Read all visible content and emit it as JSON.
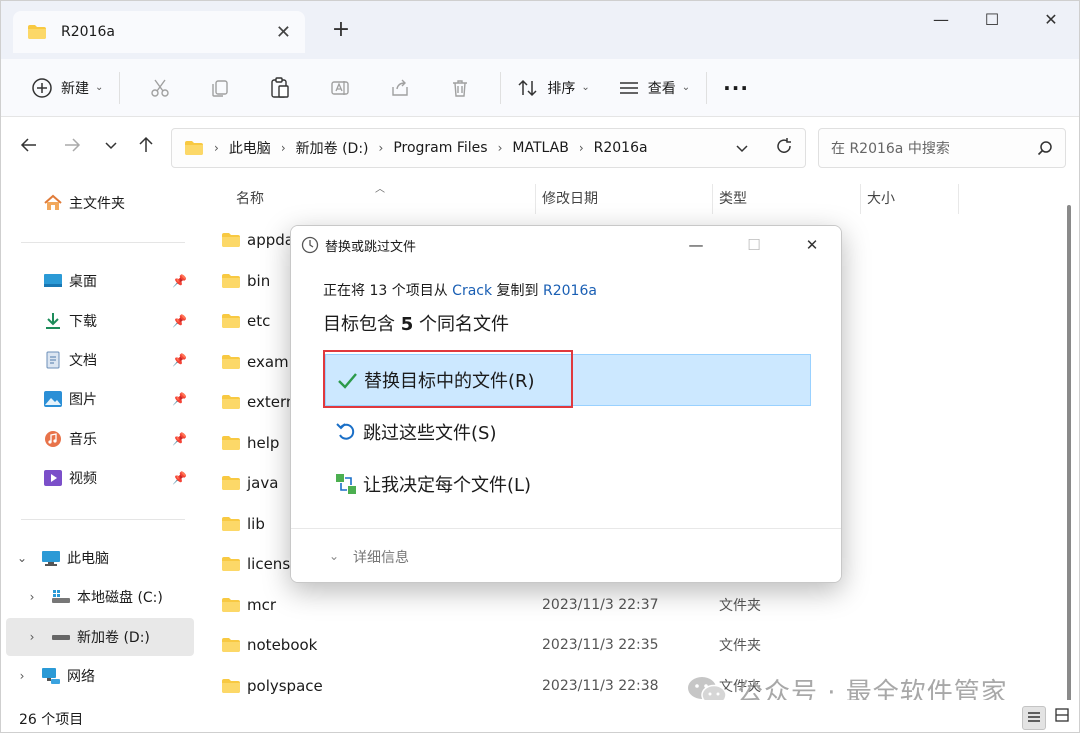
{
  "window": {
    "tab_title": "R2016a",
    "tab_close": "✕",
    "new_tab": "+",
    "minimize": "—",
    "maximize": "☐",
    "close": "✕"
  },
  "toolbar": {
    "new_label": "新建",
    "sort_label": "排序",
    "view_label": "查看",
    "more_label": "···"
  },
  "address": {
    "crumbs": [
      "此电脑",
      "新加卷 (D:)",
      "Program Files",
      "MATLAB",
      "R2016a"
    ],
    "search_placeholder": "在 R2016a 中搜索"
  },
  "sidebar": {
    "home": "主文件夹",
    "quick": [
      {
        "label": "桌面",
        "icon": "desktop-icon"
      },
      {
        "label": "下载",
        "icon": "download-icon"
      },
      {
        "label": "文档",
        "icon": "document-icon"
      },
      {
        "label": "图片",
        "icon": "pictures-icon"
      },
      {
        "label": "音乐",
        "icon": "music-icon"
      },
      {
        "label": "视频",
        "icon": "video-icon"
      }
    ],
    "this_pc": "此电脑",
    "drive_c": "本地磁盘 (C:)",
    "drive_d": "新加卷 (D:)",
    "network": "网络"
  },
  "columns": {
    "name": "名称",
    "date": "修改日期",
    "type": "类型",
    "size": "大小"
  },
  "files": [
    {
      "name": "appda",
      "date": "",
      "type": ""
    },
    {
      "name": "bin",
      "date": "",
      "type": ""
    },
    {
      "name": "etc",
      "date": "",
      "type": ""
    },
    {
      "name": "examp",
      "date": "",
      "type": ""
    },
    {
      "name": "extern",
      "date": "",
      "type": ""
    },
    {
      "name": "help",
      "date": "",
      "type": ""
    },
    {
      "name": "java",
      "date": "",
      "type": ""
    },
    {
      "name": "lib",
      "date": "",
      "type": ""
    },
    {
      "name": "licens",
      "date": "",
      "type": ""
    },
    {
      "name": "mcr",
      "date": "2023/11/3 22:37",
      "type": "文件夹"
    },
    {
      "name": "notebook",
      "date": "2023/11/3 22:35",
      "type": "文件夹"
    },
    {
      "name": "polyspace",
      "date": "2023/11/3 22:38",
      "type": "文件夹"
    }
  ],
  "status": {
    "item_count": "26 个项目"
  },
  "watermark": {
    "text": "公众号 · 最全软件管家"
  },
  "dialog": {
    "title": "替换或跳过文件",
    "line1_prefix": "正在将 13 个项目从 ",
    "line1_source": "Crack",
    "line1_middle": " 复制到 ",
    "line1_dest": "R2016a",
    "line2_prefix": "目标包含 ",
    "line2_count": "5",
    "line2_suffix": " 个同名文件",
    "option_replace": "替换目标中的文件(R)",
    "option_skip": "跳过这些文件(S)",
    "option_decide": "让我决定每个文件(L)",
    "details": "详细信息"
  },
  "colors": {
    "accent": "#1a5fb4",
    "highlight": "#cce8ff",
    "annotation_red": "#e0393e",
    "folder": "#f8c942"
  }
}
